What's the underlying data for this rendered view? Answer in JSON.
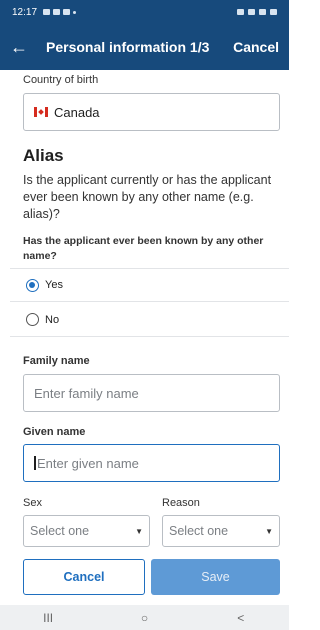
{
  "status_bar": {
    "time": "12:17"
  },
  "app_bar": {
    "back_label": "←",
    "title": "Personal information 1/3",
    "cancel_label": "Cancel"
  },
  "country_of_birth": {
    "label": "Country of birth",
    "value": "Canada"
  },
  "alias": {
    "heading": "Alias",
    "description": "Is the applicant currently or has the applicant ever been known by any other name (e.g. alias)?",
    "question": "Has the applicant ever been known by any other name?",
    "options": [
      {
        "label": "Yes",
        "checked": true
      },
      {
        "label": "No",
        "checked": false
      }
    ]
  },
  "family_name": {
    "label": "Family name",
    "placeholder": "Enter family name"
  },
  "given_name": {
    "label": "Given name",
    "placeholder": "Enter given name"
  },
  "sex": {
    "label": "Sex",
    "value": "Select one"
  },
  "reason": {
    "label": "Reason",
    "value": "Select one"
  },
  "actions": {
    "cancel_label": "Cancel",
    "save_label": "Save"
  },
  "nav": {
    "recents": "III",
    "home": "○",
    "back": "<"
  },
  "colors": {
    "header": "#174a7c",
    "accent": "#1f6fbf",
    "save_disabled": "#5e9ad6"
  }
}
